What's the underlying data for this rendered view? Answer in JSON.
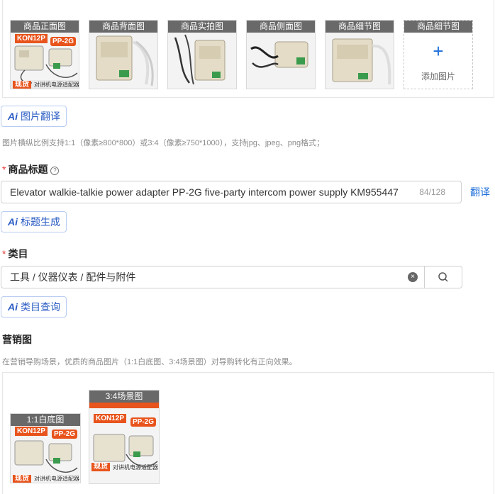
{
  "gallery": {
    "images": [
      {
        "caption": "商品正面图",
        "badge1": "KON12P",
        "badge2": "PP-2G",
        "tag": "现货",
        "banner": "对讲机电源适配器"
      },
      {
        "caption": "商品背面图"
      },
      {
        "caption": "商品实拍图"
      },
      {
        "caption": "商品侧面图"
      },
      {
        "caption": "商品细节图"
      },
      {
        "caption": "商品细节图",
        "plus": "+",
        "add_label": "添加图片"
      }
    ]
  },
  "image_translate": {
    "ai_icon": "Ai",
    "label": "图片翻译"
  },
  "image_hint": "图片横纵比例支持1:1（像素≥800*800）或3:4（像素≥750*1000），支持jpg、jpeg、png格式；",
  "title_field": {
    "required": "*",
    "label": "商品标题",
    "help": "?",
    "value": "Elevator walkie-talkie power adapter PP-2G five-party intercom power supply KM955447",
    "counter": "84/128",
    "translate_link": "翻译"
  },
  "title_generate": {
    "ai_icon": "Ai",
    "label": "标题生成"
  },
  "category_field": {
    "required": "*",
    "label": "类目",
    "value": "工具 / 仪器仪表 / 配件与附件",
    "clear": "×"
  },
  "category_query": {
    "ai_icon": "Ai",
    "label": "类目查询"
  },
  "marketing": {
    "label": "营销图",
    "hint": "在营销导购场景，优质的商品图片（1:1白底图、3:4场景图）对导购转化有正向效果。",
    "images": [
      {
        "caption": "1:1白底图",
        "badge1": "KON12P",
        "badge2": "PP-2G",
        "tag": "现货",
        "banner": "对讲机电源适配器"
      },
      {
        "caption": "3:4场景图",
        "badge1": "KON12P",
        "badge2": "PP-2G",
        "tag": "现货",
        "banner": "对讲机电源适配器"
      }
    ]
  }
}
